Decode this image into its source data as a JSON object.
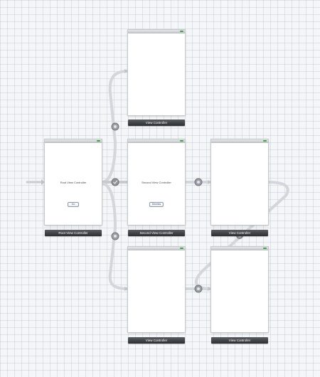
{
  "storyboard": {
    "scenes": {
      "root": {
        "title": "Root View Controller",
        "bar_label": "Root View Controller",
        "button_label": "Go"
      },
      "second": {
        "title": "Second View Controller",
        "bar_label": "Second View Controller",
        "button_label": "Dismiss"
      },
      "top": {
        "bar_label": "View Controller"
      },
      "right": {
        "bar_label": "View Controller"
      },
      "bottom": {
        "bar_label": "View Controller"
      },
      "bottom_right": {
        "bar_label": "View Controller"
      }
    },
    "colors": {
      "segue_line": "#d3d6da",
      "segue_node": "#8f959b",
      "status_indicator": "#3aa33c",
      "bar_background": "#3b3d40"
    },
    "icons": {
      "segue_node": "circle-icon",
      "entry_point": "arrow-right-icon",
      "battery": "battery-icon"
    }
  }
}
